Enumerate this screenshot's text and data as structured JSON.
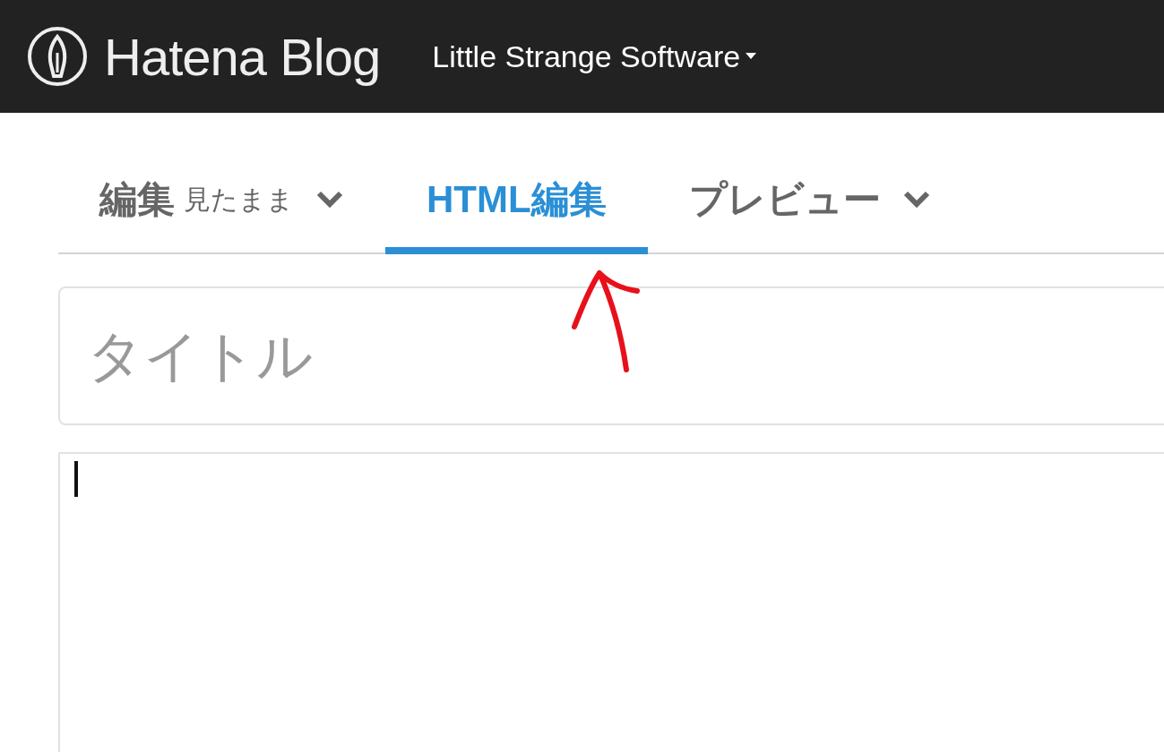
{
  "header": {
    "logo_text": "Hatena Blog",
    "blog_name": "Little Strange Software"
  },
  "tabs": [
    {
      "label": "編集",
      "sublabel": "見たまま",
      "dropdown": true,
      "selected": false
    },
    {
      "label": "HTML編集",
      "dropdown": false,
      "selected": true
    },
    {
      "label": "プレビュー",
      "dropdown": true,
      "selected": false
    }
  ],
  "title_field": {
    "placeholder": "タイトル"
  },
  "annotation": {
    "kind": "arrow"
  }
}
